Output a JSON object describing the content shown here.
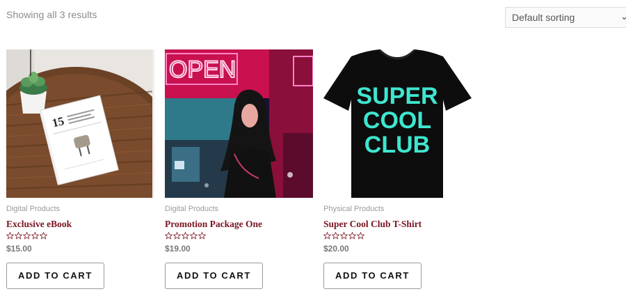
{
  "shop": {
    "results_count": "Showing all 3 results",
    "sorting": {
      "selected": "Default sorting"
    }
  },
  "products": [
    {
      "category": "Digital Products",
      "title": "Exclusive eBook",
      "rating": 0,
      "price": "$15.00",
      "button_label": "ADD TO CART"
    },
    {
      "category": "Digital Products",
      "title": "Promotion Package One",
      "rating": 0,
      "price": "$19.00",
      "button_label": "ADD TO CART"
    },
    {
      "category": "Physical Products",
      "title": "Super Cool Club T-Shirt",
      "rating": 0,
      "price": "$20.00",
      "button_label": "ADD TO CART"
    }
  ],
  "images": {
    "ebook_cover_number": "15",
    "neon_sign_text": "OPEN",
    "tshirt_lines": [
      "SUPER",
      "COOL",
      "CLUB"
    ]
  },
  "colors": {
    "title": "#7a1420",
    "category": "#9a9a9a",
    "price": "#777777",
    "neon": "#ff4fa3",
    "tshirt_print": "#3ee6d0"
  }
}
